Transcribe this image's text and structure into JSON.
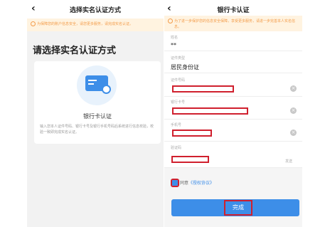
{
  "left": {
    "header_title": "选择实名认证方式",
    "notice": "为保障您的账户信息安全，请您更多服务，请完成实名认证。",
    "heading": "请选择实名认证方式",
    "option": {
      "title": "银行卡认证",
      "description": "输入您本人证件号码、银行卡号及银行手机号码后系统进行信息校验，校验一致即完成实名认证。"
    }
  },
  "right": {
    "header_title": "银行卡认证",
    "notice": "为了进一步保护您的信息安全保障，享受更多服务，请进一步完善本人实名信息。",
    "fields": [
      {
        "label": "姓名",
        "value": "**"
      },
      {
        "label": "证件类型",
        "value": "居民身份证"
      },
      {
        "label": "证件号码",
        "value": ""
      },
      {
        "label": "银行卡号",
        "value": ""
      },
      {
        "label": "手机号",
        "value": ""
      },
      {
        "label": "验证码",
        "value": ""
      }
    ],
    "code_hint": "发送",
    "agree_prefix": "同意",
    "agree_link": "《授权协议》",
    "submit_label": "完成"
  }
}
